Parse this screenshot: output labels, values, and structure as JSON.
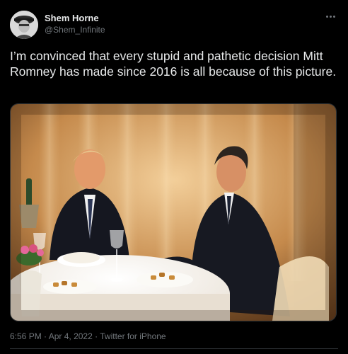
{
  "author": {
    "name": "Shem Horne",
    "handle": "@Shem_Infinite",
    "avatar_icon": "profile-photo"
  },
  "more_icon": "more-options-icon",
  "tweet_text": "I’m convinced that every stupid and pathetic decision Mitt Romney has made since 2016 is all because of this picture.",
  "media": {
    "kind": "photo"
  },
  "meta": {
    "time": "6:56 PM",
    "date": "Apr 4, 2022",
    "source": "Twitter for iPhone",
    "separator": "·"
  },
  "colors": {
    "background": "#000000",
    "text": "#e7e9ea",
    "secondary": "#71767b",
    "border": "#2f3336"
  }
}
